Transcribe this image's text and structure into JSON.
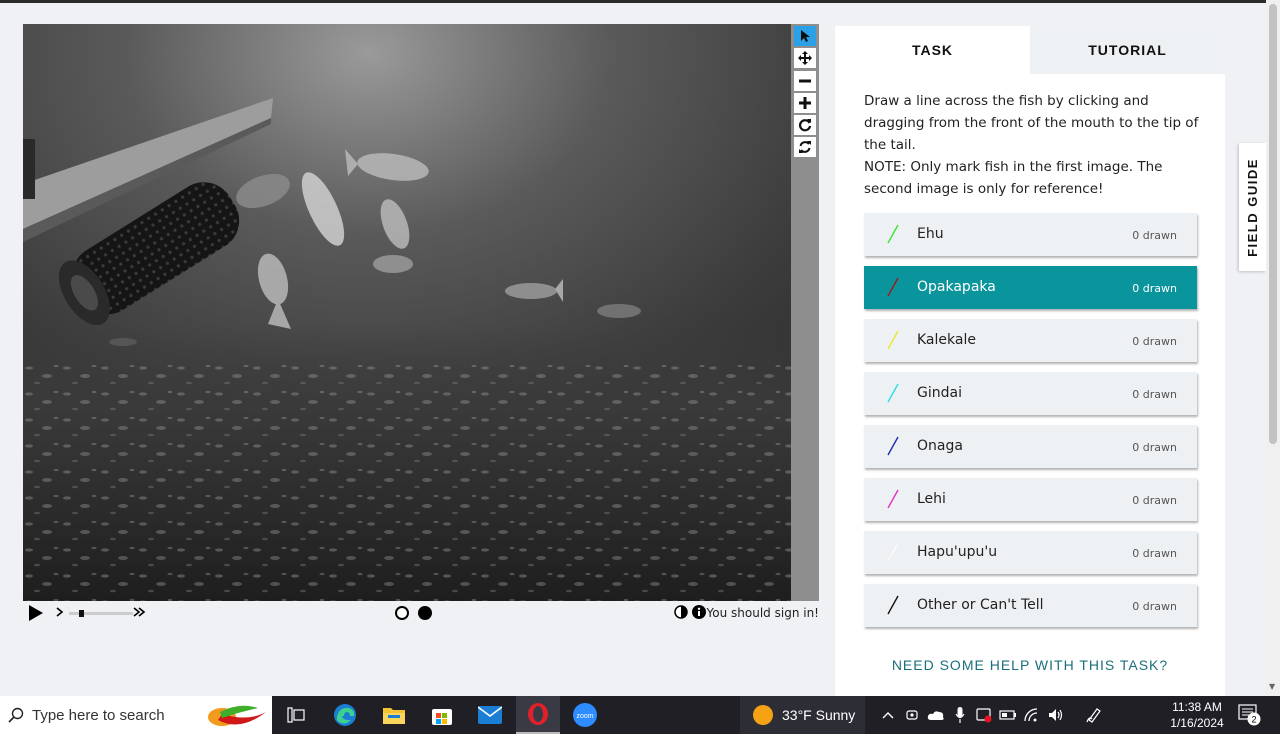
{
  "viewer": {
    "toolbar": {
      "annotate": "annotate-pointer-icon",
      "move": "move-arrows-icon",
      "zoom_out": "minus-icon",
      "zoom_in": "plus-icon",
      "rotate": "rotate-icon",
      "reset": "reset-icon"
    },
    "controls": {
      "play": "play-icon",
      "speed_slow": "chevron-right-icon",
      "speed_fast": "double-chevron-right-icon",
      "frame_dots": [
        "empty-circle",
        "filled-circle"
      ],
      "contrast": "contrast-icon",
      "info": "info-icon",
      "sign_in_text": "You should sign in!"
    }
  },
  "panel": {
    "tabs": [
      {
        "label": "TASK",
        "active": true
      },
      {
        "label": "TUTORIAL",
        "active": false
      }
    ],
    "instructions": "Draw a line across the fish by clicking and dragging from the front of the mouth to the tip of the tail.",
    "note": "NOTE: Only mark fish in the first image. The second image is only for reference!",
    "answers": [
      {
        "label": "Ehu",
        "count": "0 drawn",
        "color": "#35e635"
      },
      {
        "label": "Opakapaka",
        "count": "0 drawn",
        "color": "#a01a1a"
      },
      {
        "label": "Kalekale",
        "count": "0 drawn",
        "color": "#e8e82a"
      },
      {
        "label": "Gindai",
        "count": "0 drawn",
        "color": "#2ae0e0"
      },
      {
        "label": "Onaga",
        "count": "0 drawn",
        "color": "#1a2aa8"
      },
      {
        "label": "Lehi",
        "count": "0 drawn",
        "color": "#e030c8"
      },
      {
        "label": "Hapu'upu'u",
        "count": "0 drawn",
        "color": "#fafafa"
      },
      {
        "label": "Other or Can't Tell",
        "count": "0 drawn",
        "color": "#111111"
      }
    ],
    "selected_answer": "Opakapaka",
    "help_link": "NEED SOME HELP WITH THIS TASK?",
    "accent": "#0a949c"
  },
  "field_guide": "FIELD GUIDE",
  "taskbar": {
    "search_placeholder": "Type here to search",
    "apps": [
      "task-view-icon",
      "edge-icon",
      "file-explorer-icon",
      "store-icon",
      "mail-icon",
      "opera-icon",
      "zoom-icon"
    ],
    "zoom_label": "zoom",
    "weather": "33°F  Sunny",
    "time": "11:38 AM",
    "date": "1/16/2024",
    "notifications": "2"
  }
}
